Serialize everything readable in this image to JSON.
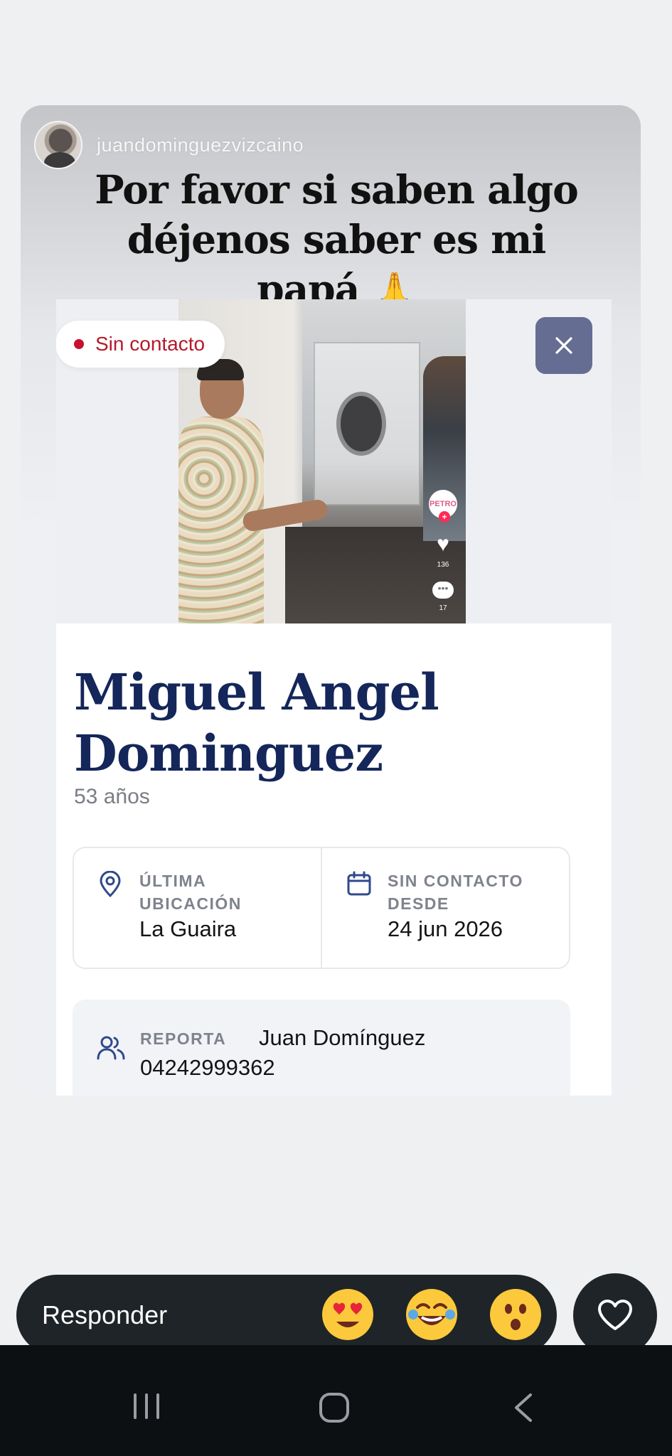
{
  "story": {
    "username": "juandominguezvizcaino",
    "caption_lines": [
      "Por favor si saben algo",
      "déjenos saber es mi",
      "papá"
    ],
    "caption_emoji": "🙏"
  },
  "card": {
    "status": "Sin contacto",
    "close_icon": "close-icon",
    "tiktok": {
      "likes": "136",
      "comments": "17",
      "badge": "PETRO"
    },
    "name": "Miguel Angel Dominguez",
    "age": "53 años",
    "last_location": {
      "label": "ÚLTIMA UBICACIÓN",
      "value": "La Guaira"
    },
    "no_contact_since": {
      "label": "SIN CONTACTO DESDE",
      "value": "24 jun 2026"
    },
    "reporter": {
      "label": "REPORTA",
      "name": "Juan Domínguez",
      "phone": "04242999362"
    },
    "accent_color": "#14265a",
    "status_color": "#c8102e"
  },
  "reply": {
    "placeholder": "Responder",
    "reactions": [
      "heart-eyes",
      "tears-of-joy",
      "surprised"
    ]
  },
  "nav": {
    "items": [
      "recents-icon",
      "home-icon",
      "back-icon"
    ]
  }
}
